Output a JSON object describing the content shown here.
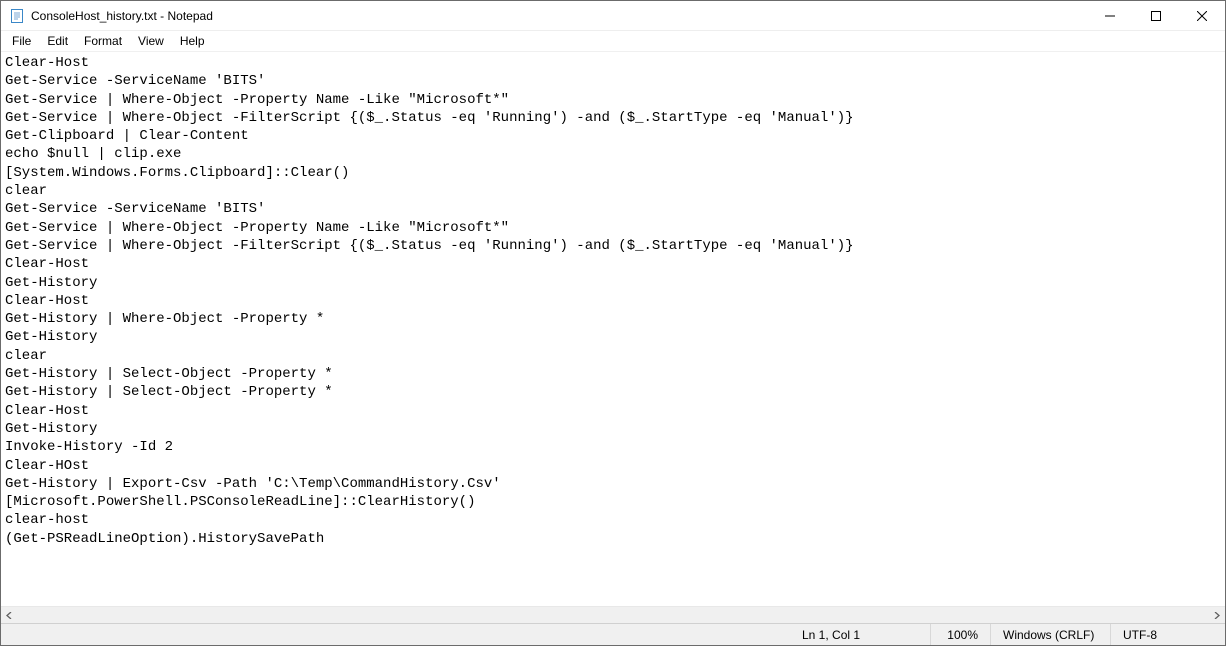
{
  "titlebar": {
    "title": "ConsoleHost_history.txt - Notepad"
  },
  "menubar": {
    "items": [
      {
        "label": "File"
      },
      {
        "label": "Edit"
      },
      {
        "label": "Format"
      },
      {
        "label": "View"
      },
      {
        "label": "Help"
      }
    ]
  },
  "editor": {
    "content": "Clear-Host\nGet-Service -ServiceName 'BITS'\nGet-Service | Where-Object -Property Name -Like \"Microsoft*\"\nGet-Service | Where-Object -FilterScript {($_.Status -eq 'Running') -and ($_.StartType -eq 'Manual')}\nGet-Clipboard | Clear-Content\necho $null | clip.exe\n[System.Windows.Forms.Clipboard]::Clear()\nclear\nGet-Service -ServiceName 'BITS'\nGet-Service | Where-Object -Property Name -Like \"Microsoft*\"\nGet-Service | Where-Object -FilterScript {($_.Status -eq 'Running') -and ($_.StartType -eq 'Manual')}\nClear-Host\nGet-History\nClear-Host\nGet-History | Where-Object -Property *\nGet-History\nclear\nGet-History | Select-Object -Property *\nGet-History | Select-Object -Property *\nClear-Host\nGet-History\nInvoke-History -Id 2\nClear-HOst\nGet-History | Export-Csv -Path 'C:\\Temp\\CommandHistory.Csv'\n[Microsoft.PowerShell.PSConsoleReadLine]::ClearHistory()\nclear-host\n(Get-PSReadLineOption).HistorySavePath"
  },
  "statusbar": {
    "position": "Ln 1, Col 1",
    "zoom": "100%",
    "line_ending": "Windows (CRLF)",
    "encoding": "UTF-8"
  },
  "icons": {
    "notepad": "notepad-icon",
    "minimize": "minimize-icon",
    "maximize": "maximize-icon",
    "close": "close-icon"
  }
}
